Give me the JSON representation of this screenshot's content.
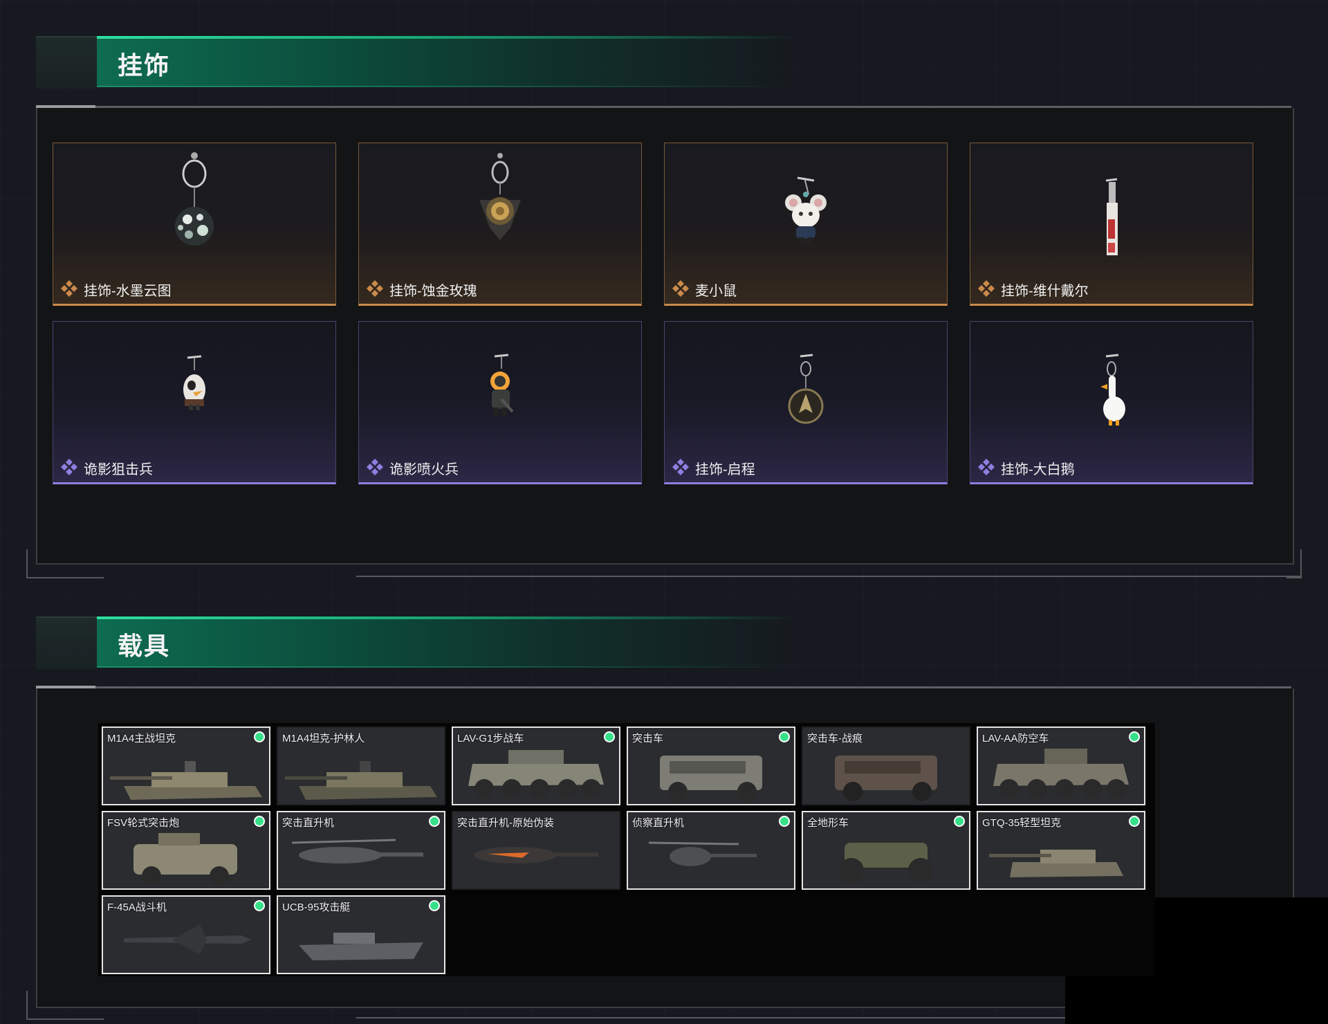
{
  "sections": {
    "charms": {
      "title": "挂饰",
      "items": [
        {
          "name": "挂饰-水墨云图",
          "rarity": "gold"
        },
        {
          "name": "挂饰-蚀金玫瑰",
          "rarity": "gold"
        },
        {
          "name": "麦小鼠",
          "rarity": "gold"
        },
        {
          "name": "挂饰-维什戴尔",
          "rarity": "gold"
        },
        {
          "name": "诡影狙击兵",
          "rarity": "purple"
        },
        {
          "name": "诡影喷火兵",
          "rarity": "purple"
        },
        {
          "name": "挂饰-启程",
          "rarity": "purple"
        },
        {
          "name": "挂饰-大白鹅",
          "rarity": "purple"
        }
      ]
    },
    "vehicles": {
      "title": "载具",
      "items": [
        {
          "name": "M1A4主战坦克",
          "owned": true
        },
        {
          "name": "M1A4坦克-护林人",
          "owned": false
        },
        {
          "name": "LAV-G1步战车",
          "owned": true
        },
        {
          "name": "突击车",
          "owned": true
        },
        {
          "name": "突击车-战痕",
          "owned": false
        },
        {
          "name": "LAV-AA防空车",
          "owned": true
        },
        {
          "name": "FSV轮式突击炮",
          "owned": true
        },
        {
          "name": "突击直升机",
          "owned": true
        },
        {
          "name": "突击直升机-原始伪装",
          "owned": false
        },
        {
          "name": "侦察直升机",
          "owned": true
        },
        {
          "name": "全地形车",
          "owned": true
        },
        {
          "name": "GTQ-35轻型坦克",
          "owned": true
        },
        {
          "name": "F-45A战斗机",
          "owned": true
        },
        {
          "name": "UCB-95攻击艇",
          "owned": true
        }
      ]
    }
  },
  "colors": {
    "accent_green": "#36e089",
    "rarity_gold": "#c98a4c",
    "rarity_purple": "#8f7fe0",
    "header_green": "#0e6c50"
  },
  "icons": {
    "rarity_gold": "diamond-cluster-icon",
    "rarity_purple": "diamond-cluster-icon",
    "owned": "green-dot-icon"
  }
}
